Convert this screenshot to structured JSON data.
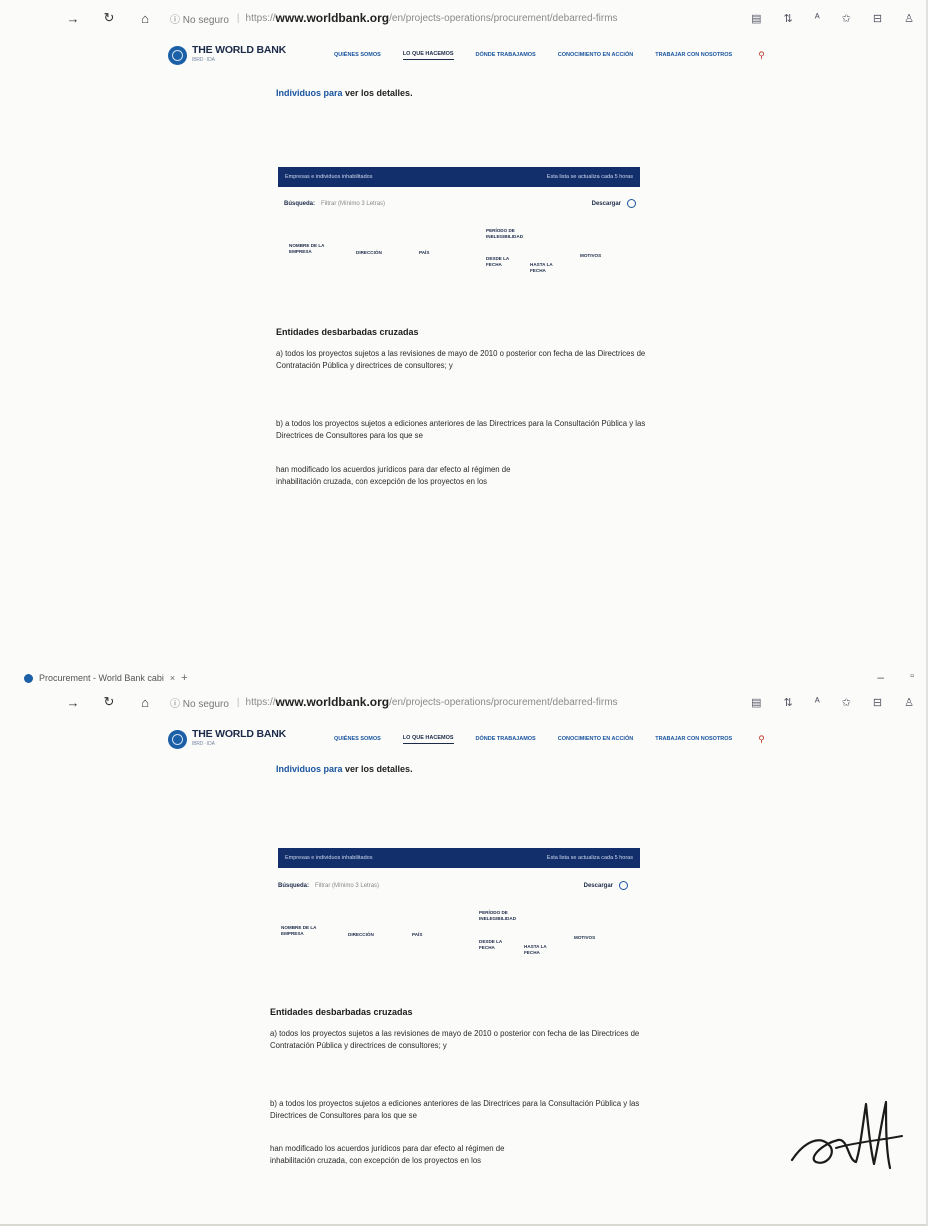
{
  "browser": {
    "tab_title": "Procurement - World Bank cabi",
    "tab_close": "×",
    "tab_new": "+",
    "window_minimize": "–",
    "window_restore": "▫",
    "nav_back": "→",
    "nav_reload": "↻",
    "nav_home": "⌂",
    "security_label": "No seguro",
    "url_prefix": "https://",
    "url_host": "www.worldbank.org",
    "url_path": "/en/projects-operations/procurement/debarred-firms"
  },
  "site": {
    "logo_text": "THE WORLD BANK",
    "logo_sub": "IBRD · IDA",
    "menu": [
      {
        "label": "Quiénes somos"
      },
      {
        "label": "Lo que hacemos",
        "active": true
      },
      {
        "label": "Dónde trabajamos"
      },
      {
        "label": "Conocimiento en acción"
      },
      {
        "label": "Trabajar con nosotros"
      }
    ]
  },
  "content": {
    "intro_link": "Individuos para",
    "intro_rest": "ver los detalles.",
    "table": {
      "header_left": "Empresas e individuos inhabilitados",
      "header_right": "Esta lista se actualiza cada 5 horas",
      "search_label": "Búsqueda:",
      "search_value": "Filtrar (Mínimo 3 Letras)",
      "download_label": "Descargar",
      "columns": {
        "firm_name": "Nombre de la empresa",
        "address": "Dirección",
        "country": "País",
        "period": "Período de inelegibilidad",
        "from_date": "Desde la fecha",
        "to_date": "Hasta la fecha",
        "grounds": "Motivos"
      }
    },
    "section_title": "Entidades desbarbadas cruzadas",
    "paragraphs": [
      "a) todos los proyectos sujetos a las revisiones de mayo de 2010 o posterior con fecha de las Directrices de Contratación Pública y directrices de consultores; y",
      "b) a todos los proyectos sujetos a ediciones anteriores de las Directrices para la Consultación Pública y las Directrices de Consultores para los que se",
      "han modificado los acuerdos jurídicos para dar efecto al régimen de inhabilitación cruzada, con excepción de los proyectos en los"
    ]
  }
}
